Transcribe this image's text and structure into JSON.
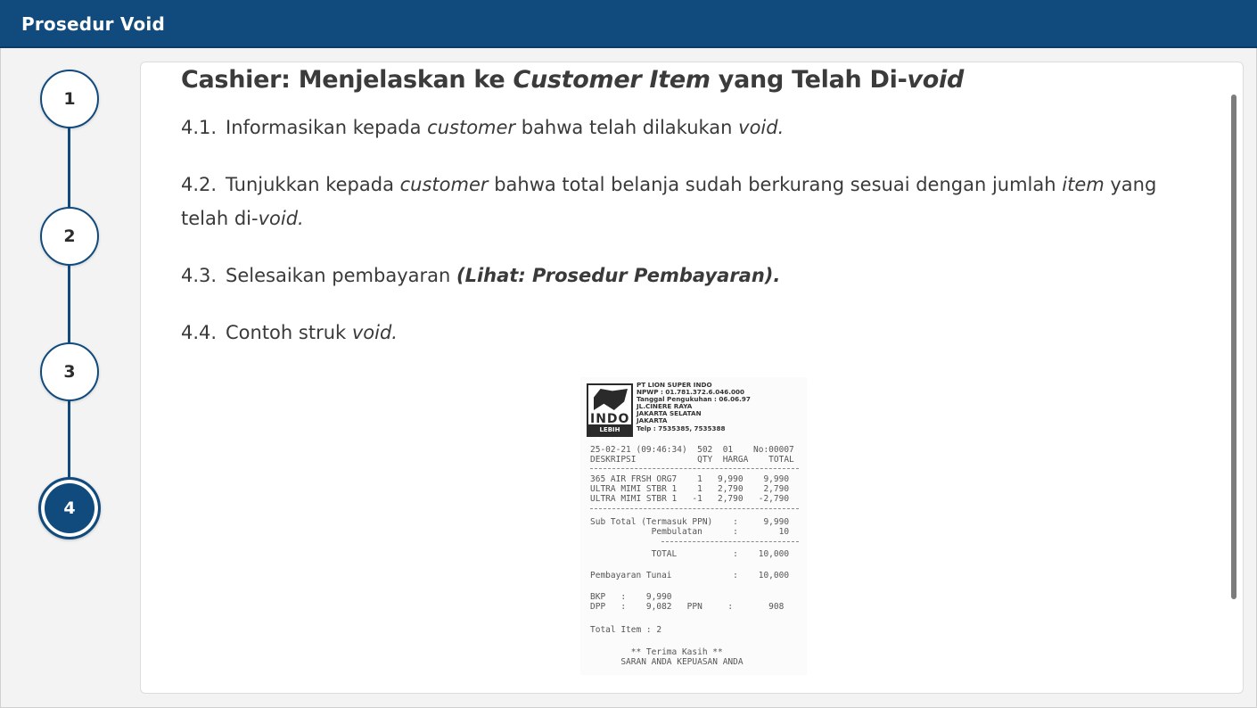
{
  "window": {
    "title": "Prosedur Void"
  },
  "stepper": {
    "steps": [
      {
        "label": "1"
      },
      {
        "label": "2"
      },
      {
        "label": "3"
      },
      {
        "label": "4"
      }
    ],
    "active_index": 3
  },
  "content": {
    "heading": {
      "prefix": "Cashier: Menjelaskan ke ",
      "italic1": "Customer Item",
      "middle": " yang Telah Di-",
      "italic2": "void"
    },
    "p1": {
      "num": "4.1.",
      "a": "Informasikan kepada ",
      "b": "customer",
      "c": " bahwa telah dilakukan ",
      "d": "void."
    },
    "p2": {
      "num": "4.2.",
      "a": "Tunjukkan kepada ",
      "b": "customer",
      "c": " bahwa total belanja sudah berkurang sesuai dengan jumlah ",
      "d": "item",
      "e": " yang telah di-",
      "f": "void."
    },
    "p3": {
      "num": "4.3.",
      "a": "Selesaikan pembayaran ",
      "b": "(Lihat: Prosedur Pembayaran)."
    },
    "p4": {
      "num": "4.4.",
      "a": "Contoh struk ",
      "b": "void."
    }
  },
  "receipt": {
    "logo_brand": "INDO",
    "logo_tag": "LEBIH MURAH",
    "header_lines": "PT LION SUPER INDO\nNPWP : 01.781.372.6.046.000\nTanggal Pengukuhan : 06.06.97\nJL.CINERE RAYA\nJAKARTA SELATAN\nJAKARTA\nTelp : 7535385, 7535388",
    "line_date": "25-02-21 (09:46:34)  502  01    No:00007",
    "line_cols": "DESKRIPSI            QTY  HARGA    TOTAL",
    "items": [
      "365 AIR FRSH ORG7    1   9,990    9,990",
      "ULTRA MIMI STBR 1    1   2,790    2,790",
      "ULTRA MIMI STBR 1   -1   2,790   -2,790"
    ],
    "subtotal": "Sub Total (Termasuk PPN)    :     9,990",
    "pembulatan": "            Pembulatan      :        10",
    "total": "            TOTAL           :    10,000",
    "tunai": "Pembayaran Tunai            :    10,000",
    "bkp": "BKP   :    9,990",
    "dpp": "DPP   :    9,082   PPN     :       908",
    "total_item": "Total Item : 2",
    "thanks": "        ** Terima Kasih **",
    "saran": "      SARAN ANDA KEPUASAN ANDA"
  },
  "colors": {
    "header_bg": "#114b7e",
    "accent": "#114b7e"
  }
}
